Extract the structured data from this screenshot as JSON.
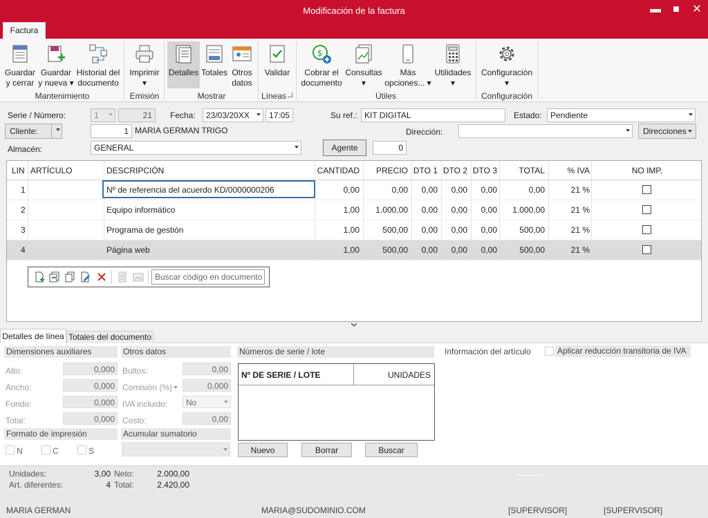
{
  "window": {
    "title": "Modificación de la factura",
    "min": "▬",
    "max": "■",
    "close": "✕"
  },
  "ribbon": {
    "tab": "Factura",
    "buttons": {
      "guardar_cerrar": [
        "Guardar",
        "y cerrar"
      ],
      "guardar_nueva": [
        "Guardar",
        "y nueva ▾"
      ],
      "historial": [
        "Historial del",
        "documento"
      ],
      "imprimir": [
        "Imprimir",
        "▾"
      ],
      "detalles": [
        "Detalles",
        ""
      ],
      "totales": [
        "Totales",
        ""
      ],
      "otros": [
        "Otros",
        "datos"
      ],
      "validar": [
        "Validar",
        ""
      ],
      "cobrar": [
        "Cobrar el",
        "documento"
      ],
      "consultas": [
        "Consultas",
        "▾"
      ],
      "mas": [
        "Más",
        "opciones... ▾"
      ],
      "utilidades": [
        "Utilidades",
        "▾"
      ],
      "configuracion": [
        "Configuración",
        "▾"
      ]
    },
    "groups": {
      "mantenimiento": "Mantenimiento",
      "emision": "Emisión",
      "mostrar": "Mostrar",
      "lineas": "Líneas",
      "utiles": "Útiles",
      "configuracion": "Configuración"
    }
  },
  "header": {
    "serie_label": "Serie / Número:",
    "serie_value": "1",
    "numero_value": "21",
    "fecha_label": "Fecha:",
    "fecha_value": "23/03/20XX",
    "hora_value": "17:05",
    "suref_label": "Su ref.:",
    "suref_value": "KIT DIGITAL",
    "estado_label": "Estado:",
    "estado_value": "Pendiente",
    "cliente_button": "Cliente:",
    "cliente_code": "1",
    "cliente_name": "MARIA GERMAN TRIGO",
    "direccion_label": "Dirección:",
    "direccion_value": "",
    "direcciones_button": "Direcciones",
    "almacen_label": "Almacén:",
    "almacen_value": "GENERAL",
    "agente_button": "Agente",
    "agente_value": "0"
  },
  "grid": {
    "columns": [
      "LIN",
      "ARTÍCULO",
      "DESCRIPCIÓN",
      "CANTIDAD",
      "PRECIO",
      "DTO 1",
      "DTO 2",
      "DTO 3",
      "TOTAL",
      "% IVA",
      "NO IMP."
    ],
    "rows": [
      {
        "lin": "1",
        "articulo": "",
        "descripcion": "Nº de referencia del acuerdo KD/0000000206",
        "cantidad": "0,00",
        "precio": "0,00",
        "dto1": "0,00",
        "dto2": "0,00",
        "dto3": "0,00",
        "total": "0,00",
        "iva": "21 %",
        "noimp": false
      },
      {
        "lin": "2",
        "articulo": "",
        "descripcion": "Equipo informático",
        "cantidad": "1,00",
        "precio": "1.000,00",
        "dto1": "0,00",
        "dto2": "0,00",
        "dto3": "0,00",
        "total": "1.000,00",
        "iva": "21 %",
        "noimp": false
      },
      {
        "lin": "3",
        "articulo": "",
        "descripcion": "Programa de gestión",
        "cantidad": "1,00",
        "precio": "500,00",
        "dto1": "0,00",
        "dto2": "0,00",
        "dto3": "0,00",
        "total": "500,00",
        "iva": "21 %",
        "noimp": false
      },
      {
        "lin": "4",
        "articulo": "",
        "descripcion": "Página web",
        "cantidad": "1,00",
        "precio": "500,00",
        "dto1": "0,00",
        "dto2": "0,00",
        "dto3": "0,00",
        "total": "500,00",
        "iva": "21 %",
        "noimp": false
      }
    ],
    "search_placeholder": "Buscar código en documento"
  },
  "tabs": {
    "detalles": "Detalles de línea",
    "totales": "Totales del documento"
  },
  "details": {
    "dim_title": "Dimensiones auxiliares",
    "alto_label": "Alto:",
    "alto": "0,000",
    "ancho_label": "Ancho:",
    "ancho": "0,000",
    "fondo_label": "Fondo:",
    "fondo": "0,000",
    "total_label": "Total:",
    "total": "0,000",
    "otros_title": "Otros datos",
    "bultos_label": "Bultos:",
    "bultos": "0,00",
    "comision_label": "Comisión (%)",
    "comision": "0,000",
    "iva_label": "IVA incluido:",
    "iva": "No",
    "costo_label": "Costo:",
    "costo": "0,00",
    "formato_title": "Formato de impresión",
    "fmt_n": "N",
    "fmt_c": "C",
    "fmt_s": "S",
    "acumular_title": "Acumular sumatorio",
    "series_title": "Números de serie / lote",
    "series_col1": "Nº DE SERIE / LOTE",
    "series_col2": "UNIDADES",
    "nuevo": "Nuevo",
    "borrar": "Borrar",
    "buscar": "Buscar",
    "info_title": "Información del artículo",
    "reduccion_label": "Aplicar reducción transitoria de IVA"
  },
  "summary": {
    "unidades_label": "Unidades:",
    "unidades": "3,00",
    "neto_label": "Neto:",
    "neto": "2.000,00",
    "art_label": "Art. diferentes:",
    "art": "4",
    "total_label": "Total:",
    "total": "2.420,00"
  },
  "status": {
    "user": "MARIA GERMAN",
    "email": "MARIA@SUDOMINIO.COM",
    "role1": "[SUPERVISOR]",
    "role2": "[SUPERVISOR]"
  },
  "colors": {
    "brand": "#c8102e",
    "selected_row": "#dcdcdc"
  }
}
